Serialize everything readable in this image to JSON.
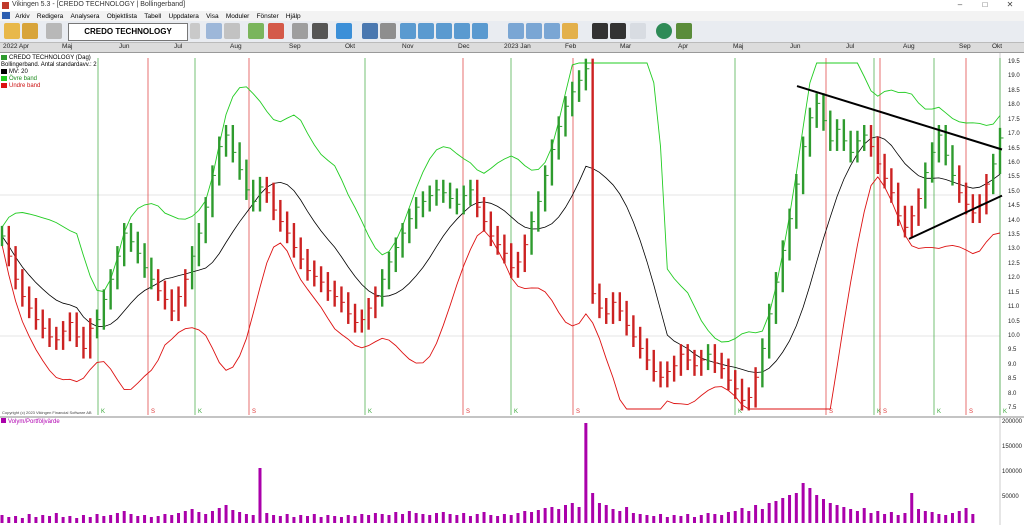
{
  "window": {
    "title": "Vikingen 5.3 - [CREDO TECHNOLOGY | Bollingerband]"
  },
  "menu": [
    "Arkiv",
    "Redigera",
    "Analysera",
    "Objektlista",
    "Tabell",
    "Uppdatera",
    "Visa",
    "Moduler",
    "Fönster",
    "Hjälp"
  ],
  "toolbar": {
    "ticker": "CREDO TECHNOLOGY"
  },
  "timeline": [
    "2022 Apr",
    "Maj",
    "Jun",
    "Jul",
    "Aug",
    "Sep",
    "Okt",
    "Nov",
    "Dec",
    "2023 Jan",
    "Feb",
    "Mar",
    "Apr",
    "Maj",
    "Jun",
    "Jul",
    "Aug",
    "Sep",
    "Okt"
  ],
  "legend": {
    "name": "CREDO TECHNOLOGY (Dag)",
    "indicator": "Bollingerband. Antal standardavv.: 2",
    "ma": "MV: 20",
    "upper": "Övre band",
    "lower": "Undre band"
  },
  "colors": {
    "up": "#2e9b2e",
    "down": "#cc2222",
    "ma": "#000000",
    "upper": "#22cc22",
    "lower": "#dd1111",
    "volume": "#aa00aa"
  },
  "price_axis": [
    "19.5",
    "19.0",
    "18.5",
    "18.0",
    "17.5",
    "17.0",
    "16.5",
    "16.0",
    "15.5",
    "15.0",
    "14.5",
    "14.0",
    "13.5",
    "13.0",
    "12.5",
    "12.0",
    "11.5",
    "11.0",
    "10.5",
    "10.0",
    "9.5",
    "9.0",
    "8.5",
    "8.0",
    "7.5"
  ],
  "volume_axis": [
    "200000",
    "150000",
    "100000",
    "50000"
  ],
  "volume_legend": "Volym/Portföljvärde",
  "copyright": "Copyright (c) 2023 Vikingen Financial Software AB",
  "signals": [
    "K",
    "S",
    "K",
    "S",
    "K",
    "S",
    "K",
    "S",
    "K",
    "S",
    "K",
    "S",
    "K",
    "S",
    "K"
  ],
  "chart_data": {
    "type": "line",
    "y_range": [
      7.5,
      19.5
    ],
    "close": [
      13.5,
      12.8,
      12.0,
      11.4,
      11.0,
      10.6,
      10.3,
      10.0,
      9.9,
      10.2,
      10.5,
      10.0,
      9.6,
      10.3,
      10.6,
      11.3,
      12.0,
      12.8,
      13.6,
      13.3,
      12.9,
      12.4,
      12.0,
      11.6,
      11.3,
      10.9,
      11.4,
      12.0,
      12.8,
      13.6,
      14.5,
      15.6,
      16.6,
      17.0,
      16.4,
      15.8,
      15.1,
      14.7,
      15.2,
      15.0,
      14.4,
      14.0,
      13.6,
      13.1,
      12.7,
      12.3,
      12.1,
      11.9,
      11.6,
      11.4,
      11.2,
      10.8,
      10.5,
      10.6,
      11.0,
      11.4,
      12.0,
      12.6,
      13.1,
      13.6,
      14.1,
      14.5,
      14.7,
      14.9,
      15.1,
      15.0,
      14.8,
      14.6,
      14.9,
      15.1,
      14.5,
      14.0,
      13.5,
      13.2,
      12.9,
      12.4,
      12.6,
      13.2,
      14.0,
      14.7,
      15.6,
      16.5,
      17.3,
      18.0,
      18.5,
      18.9,
      19.3,
      11.5,
      11.0,
      10.8,
      11.2,
      10.9,
      10.4,
      10.0,
      9.6,
      9.2,
      8.8,
      8.6,
      8.8,
      9.0,
      9.4,
      9.2,
      9.0,
      9.2,
      9.4,
      9.1,
      8.9,
      8.5,
      8.2,
      7.8,
      7.9,
      8.6,
      9.6,
      10.8,
      11.9,
      13.0,
      14.1,
      15.3,
      16.6,
      17.6,
      18.1,
      17.5,
      16.8,
      17.2,
      16.8,
      16.4,
      16.8,
      17.0,
      16.6,
      16.0,
      15.5,
      15.0,
      14.2,
      13.8,
      14.2,
      14.8,
      15.7,
      16.4,
      17.0,
      16.3,
      15.6,
      15.0,
      14.6,
      14.3,
      14.6,
      15.3,
      16.0,
      16.9
    ],
    "volume": [
      8,
      6,
      7,
      5,
      9,
      6,
      8,
      7,
      10,
      6,
      7,
      5,
      8,
      6,
      9,
      7,
      8,
      10,
      12,
      9,
      7,
      8,
      6,
      7,
      9,
      8,
      10,
      12,
      14,
      11,
      9,
      12,
      15,
      18,
      13,
      11,
      9,
      8,
      55,
      10,
      8,
      7,
      9,
      6,
      8,
      7,
      9,
      6,
      8,
      7,
      6,
      8,
      7,
      9,
      8,
      10,
      9,
      8,
      11,
      9,
      12,
      10,
      9,
      8,
      10,
      11,
      9,
      8,
      10,
      7,
      9,
      11,
      8,
      7,
      9,
      8,
      10,
      12,
      11,
      13,
      15,
      16,
      14,
      18,
      20,
      16,
      100,
      30,
      20,
      18,
      14,
      12,
      16,
      10,
      9,
      8,
      7,
      9,
      6,
      8,
      7,
      9,
      6,
      8,
      10,
      9,
      8,
      11,
      12,
      15,
      12,
      18,
      14,
      20,
      22,
      25,
      28,
      30,
      40,
      35,
      28,
      24,
      20,
      18,
      16,
      14,
      12,
      15,
      10,
      12,
      9,
      11,
      8,
      10,
      30,
      14,
      12,
      11,
      9,
      8,
      10,
      12,
      15,
      9
    ]
  }
}
